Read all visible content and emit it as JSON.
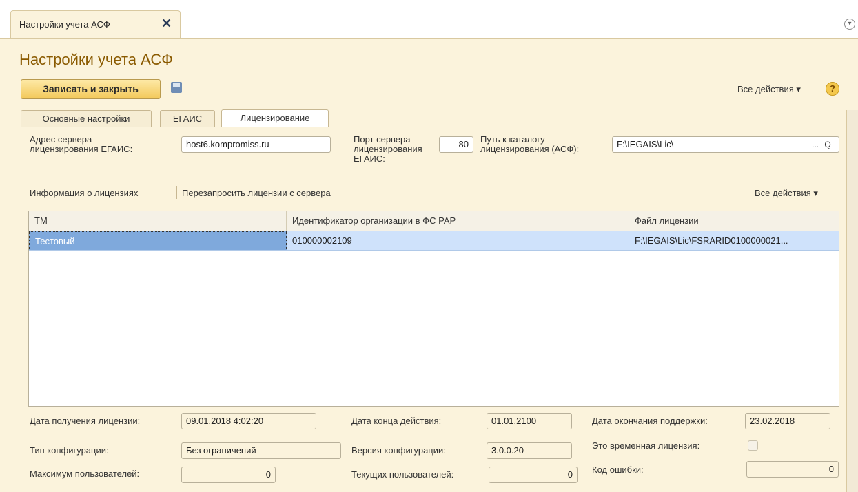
{
  "window_tab": {
    "title": "Настройки учета АСФ",
    "close_icon": "✕"
  },
  "page": {
    "title": "Настройки учета АСФ"
  },
  "toolbar": {
    "save_close_label": "Записать и закрыть",
    "all_actions_label": "Все действия ▾",
    "help_label": "?"
  },
  "tabs": [
    {
      "label": "Основные настройки"
    },
    {
      "label": "ЕГАИС"
    },
    {
      "label": "Лицензирование"
    }
  ],
  "server": {
    "address_label": "Адрес сервера\nлицензирования ЕГАИС:",
    "address_value": "host6.kompromiss.ru",
    "port_label": "Порт сервера\nлицензирования\nЕГАИС:",
    "port_value": "80",
    "path_label": "Путь к каталогу\nлицензирования (АСФ):",
    "path_value": "F:\\IEGAIS\\Lic\\",
    "path_select": "...",
    "path_search": "Q"
  },
  "license_commands": {
    "info": "Информация о лицензиях",
    "request": "Перезапросить лицензии с сервера",
    "all_actions": "Все действия ▾"
  },
  "license_table": {
    "columns": [
      "ТМ",
      "Идентификатор организации в ФС РАР",
      "Файл лицензии"
    ],
    "rows": [
      {
        "tm": "Тестовый",
        "org_id": "010000002109",
        "file": "F:\\IEGAIS\\Lic\\FSRARID0100000021..."
      }
    ]
  },
  "details": {
    "received_label": "Дата получения лицензии:",
    "received_value": "09.01.2018  4:02:20",
    "end_label": "Дата конца действия:",
    "end_value": "01.01.2100",
    "support_end_label": "Дата окончания поддержки:",
    "support_end_value": "23.02.2018",
    "config_type_label": "Тип конфигурации:",
    "config_type_value": "Без ограничений",
    "config_version_label": "Версия конфигурации:",
    "config_version_value": "3.0.0.20",
    "temporary_label": "Это временная лицензия:",
    "max_users_label": "Максимум пользователей:",
    "max_users_value": "0",
    "current_users_label": "Текущих пользователей:",
    "current_users_value": "0",
    "error_code_label": "Код ошибки:",
    "error_code_value": "0"
  }
}
